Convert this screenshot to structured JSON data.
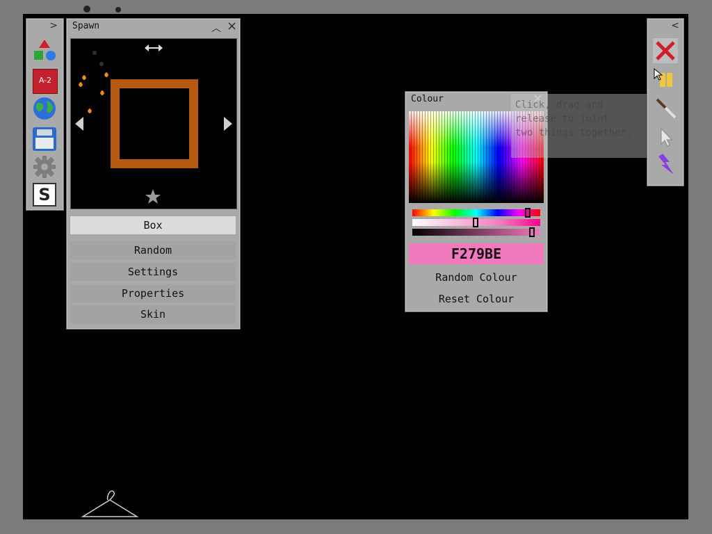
{
  "colors": {
    "viewport_bg": "#000000",
    "frame_bg": "#7b7b7b",
    "panel_bg": "#a9a9a9",
    "box_skin": "#b55a10",
    "selected_colour": "#F279BE"
  },
  "left_toolbar": {
    "collapse_glyph": ">",
    "tools": [
      {
        "name": "shapes-icon"
      },
      {
        "name": "text-a2-icon",
        "label": "A-2"
      },
      {
        "name": "globe-icon"
      },
      {
        "name": "save-disk-icon"
      },
      {
        "name": "gear-icon"
      },
      {
        "name": "s-logo-icon",
        "label": "S"
      }
    ]
  },
  "spawn": {
    "title": "Spawn",
    "buttons": {
      "minimize": "^",
      "close": "×"
    },
    "preview_icons": [
      "resize-horizontal-icon",
      "prev-arrow-icon",
      "next-arrow-icon",
      "star-icon"
    ],
    "items": [
      {
        "label": "Box",
        "active": true
      },
      {
        "label": "Random",
        "active": false
      },
      {
        "label": "Settings",
        "active": false
      },
      {
        "label": "Properties",
        "active": false
      },
      {
        "label": "Skin",
        "active": false
      }
    ]
  },
  "colour": {
    "title": "Colour",
    "hex": "F279BE",
    "hue_slider": 0.91,
    "saturation_slider": 0.49,
    "value_slider": 0.95,
    "random_label": "Random Colour",
    "reset_label": "Reset Colour"
  },
  "tooltip": {
    "text": "Click, drag and\nrelease to joint\ntwo things together."
  },
  "right_toolbar": {
    "collapse_glyph": "<",
    "tools": [
      "delete-x-icon",
      "joint-icon",
      "knife-icon",
      "pointer-icon",
      "lightning-icon"
    ]
  },
  "canvas": {
    "decor_icons": [
      "hanger-icon"
    ]
  }
}
